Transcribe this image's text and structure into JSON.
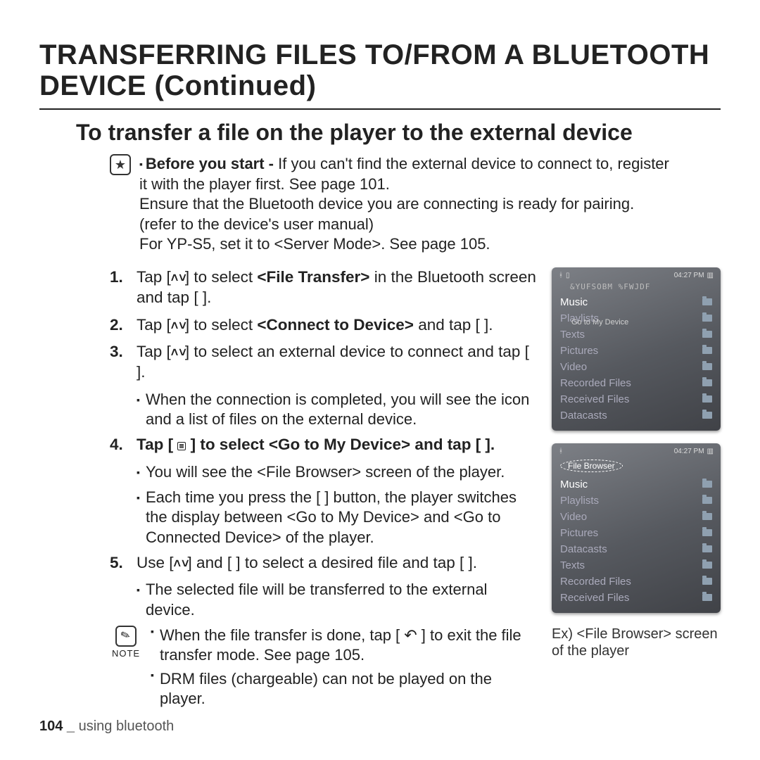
{
  "title": "TRANSFERRING FILES TO/FROM A BLUETOOTH DEVICE (Continued)",
  "subtitle": "To transfer a ﬁle on the player to the external device",
  "intro": {
    "bold_lead": "Before you start - ",
    "l1": "If you can't find the external device to connect to, register it with the player first. See page 101.",
    "l2": "Ensure that the Bluetooth device you are connecting is ready for pairing. (refer to the device's user manual)",
    "l3": "For YP-S5, set it to <Server Mode>. See page 105."
  },
  "steps": {
    "s1a": "Tap [",
    "s1b": "] to select ",
    "s1c": "<File Transfer>",
    "s1d": " in the Bluetooth screen and tap [     ].",
    "s2a": "Tap [",
    "s2b": "] to select ",
    "s2c": "<Connect to Device>",
    "s2d": " and tap [     ].",
    "s3a": "Tap [",
    "s3b": "] to select an external device to connect and tap [     ].",
    "s3sub": "When the connection is completed, you will see the       icon and a list of files on the external device.",
    "s4a": "Tap [ ",
    "s4b": " ] to select <Go to My Device> and tap [     ].",
    "s4sub1": "You will see the <File Browser> screen of the player.",
    "s4sub2": "Each time you press the [   ] button, the player switches the display between <Go to My Device> and <Go to Connected Device> of the player.",
    "s5a": "Use [",
    "s5b": "] and [     ] to select a desired file and tap [     ].",
    "s5sub": "The selected file will be transferred to the external device."
  },
  "note": {
    "label": "NOTE",
    "n1": "When the file transfer is done, tap [ ↶ ] to exit the file transfer mode. See page 105.",
    "n2": "DRM files (chargeable) can not be played on the player."
  },
  "device1": {
    "time": "04:27 PM",
    "header": "&YUFSOBM %FWJDF",
    "gotomy": "Go to My Device",
    "items": [
      "Music",
      "Playlists",
      "Texts",
      "Pictures",
      "Video",
      "Recorded Files",
      "Received Files",
      "Datacasts"
    ]
  },
  "device2": {
    "time": "04:27 PM",
    "pill": "File Browser",
    "items": [
      "Music",
      "Playlists",
      "Video",
      "Pictures",
      "Datacasts",
      "Texts",
      "Recorded Files",
      "Received Files"
    ]
  },
  "caption": "Ex) <File Browser> screen of the player",
  "footer": {
    "page": "104 _",
    "section": " using bluetooth"
  }
}
